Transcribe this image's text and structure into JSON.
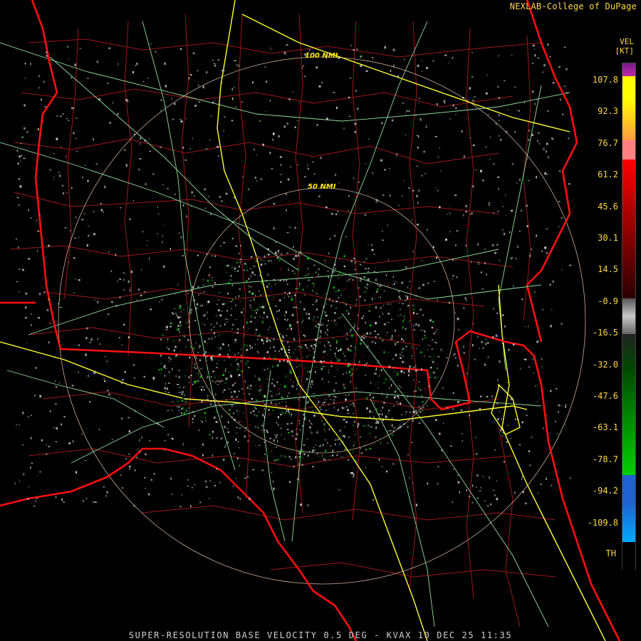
{
  "header": {
    "brand": "NEXLAB-College of DuPage",
    "product_code": "VEL",
    "units": "[KT]"
  },
  "rings": {
    "inner_label": "50 NMI",
    "outer_label": "100 NMI"
  },
  "colorscale": {
    "labels": [
      "107.8",
      "92.3",
      "76.7",
      "61.2",
      "45.6",
      "30.1",
      "14.5",
      "-0.9",
      "-16.5",
      "-32.0",
      "-47.6",
      "-63.1",
      "-78.7",
      "-94.2",
      "-109.8",
      "TH"
    ],
    "colors": {
      "purple": "#7a1a8c",
      "magenta": "#c02aa8",
      "yellow": "#ffff00",
      "orange": "#ff9a40",
      "salmon": "#ff8080",
      "red": "#ff0000",
      "darkred": "#6a0000",
      "gray": "#c8c8c8",
      "green": "#00d000",
      "darkgreen": "#004a00",
      "blue": "#2060d0",
      "cyan": "#00aaff",
      "black": "#000000"
    }
  },
  "map_colors": {
    "state_border": "#ff1010",
    "county_border": "#a01818",
    "highway": "#ffff30",
    "road": "#90e0a0",
    "range_ring": "#e8c0a8"
  },
  "footer": {
    "caption": "SUPER-RESOLUTION BASE VELOCITY 0.5 DEG - KVAX 10 DEC 25 11:35"
  }
}
